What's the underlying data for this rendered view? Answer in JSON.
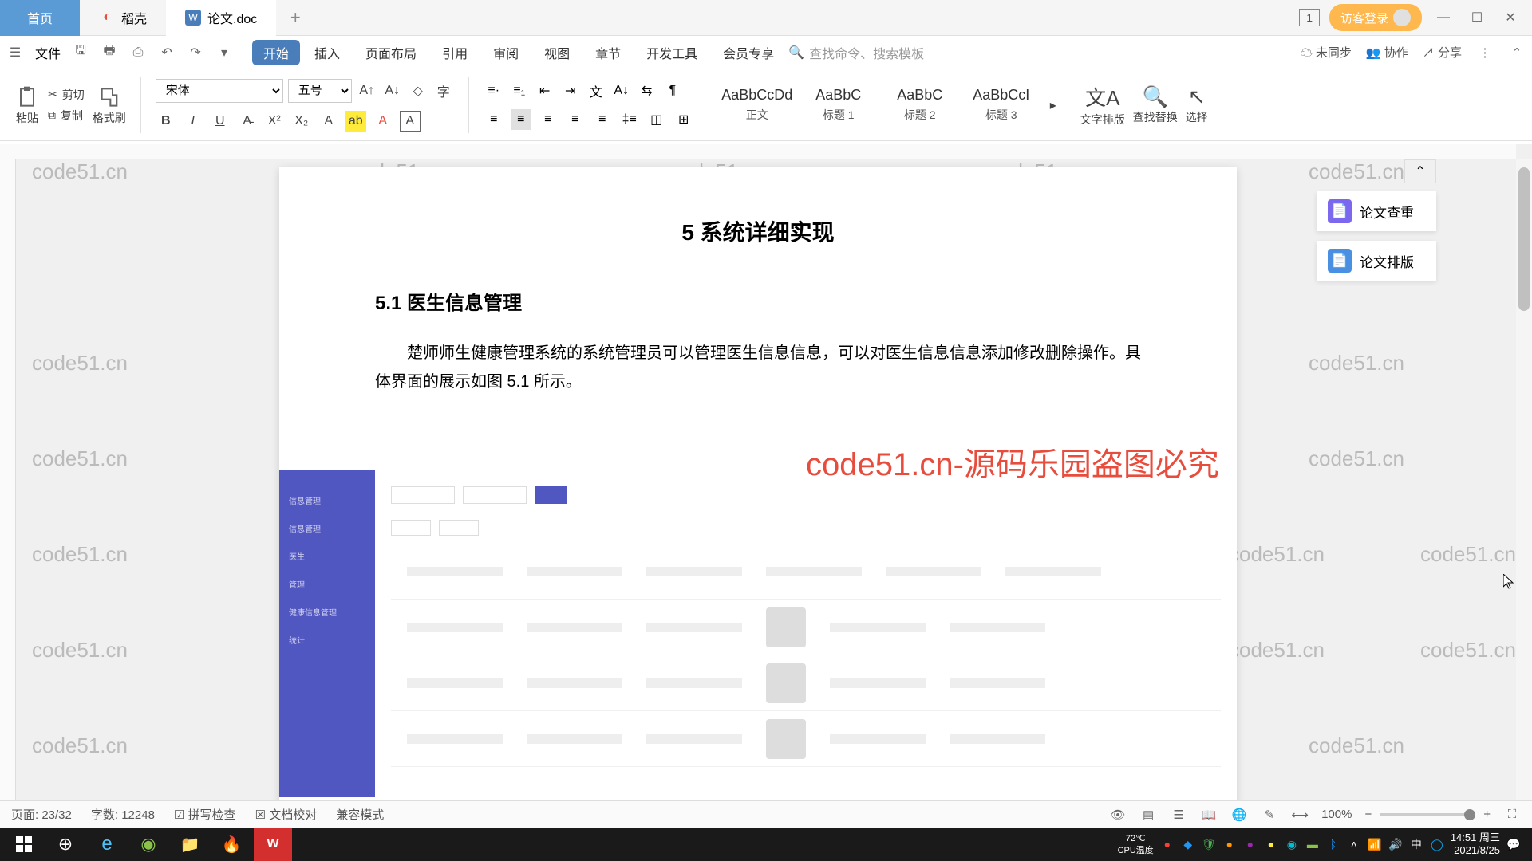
{
  "tabs": {
    "home": "首页",
    "docker": "稻壳",
    "doc": "论文.doc"
  },
  "titlebar": {
    "badge": "1",
    "login": "访客登录"
  },
  "menubar": {
    "file": "文件",
    "items": [
      "开始",
      "插入",
      "页面布局",
      "引用",
      "审阅",
      "视图",
      "章节",
      "开发工具",
      "会员专享"
    ],
    "search_placeholder": "查找命令、搜索模板",
    "right_sync": "未同步",
    "right_collab": "协作",
    "right_share": "分享"
  },
  "ribbon": {
    "paste": "粘贴",
    "cut": "剪切",
    "copy": "复制",
    "format_painter": "格式刷",
    "font_name": "宋体",
    "font_size": "五号",
    "styles": [
      {
        "preview": "AaBbCcDd",
        "label": "正文"
      },
      {
        "preview": "AaBbC",
        "label": "标题 1"
      },
      {
        "preview": "AaBbC",
        "label": "标题 2"
      },
      {
        "preview": "AaBbCcI",
        "label": "标题 3"
      }
    ],
    "text_layout": "文字排版",
    "find_replace": "查找替换",
    "select": "选择"
  },
  "document": {
    "h1": "5 系统详细实现",
    "h2": "5.1 医生信息管理",
    "p1": "楚师师生健康管理系统的系统管理员可以管理医生信息信息，可以对医生信息信息添加修改删除操作。具体界面的展示如图 5.1 所示。"
  },
  "sidepanel": {
    "check": "论文查重",
    "typeset": "论文排版"
  },
  "watermarks": {
    "text": "code51.cn",
    "red_text": "code51.cn-源码乐园盗图必究"
  },
  "statusbar": {
    "page": "页面: 23/32",
    "words": "字数: 12248",
    "spell": "拼写检查",
    "proof": "文档校对",
    "compat": "兼容模式",
    "zoom": "100%"
  },
  "taskbar": {
    "temp": "72℃",
    "cpu": "CPU温度",
    "lang": "中",
    "time": "14:51",
    "day": "周三",
    "date": "2021/8/25"
  }
}
